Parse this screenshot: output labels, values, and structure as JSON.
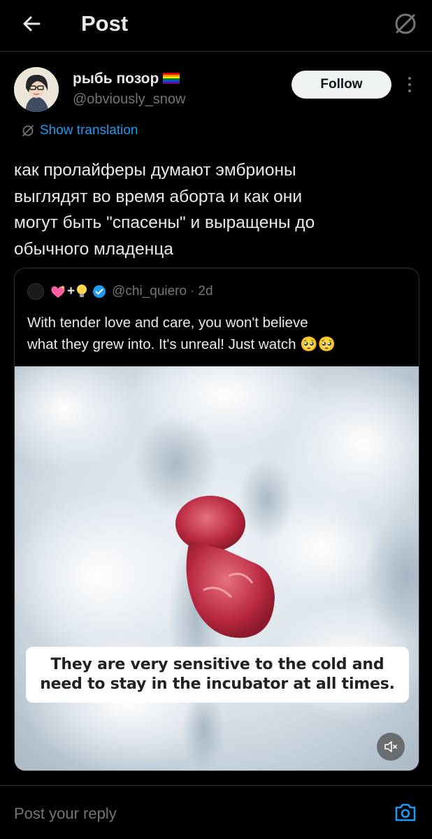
{
  "header": {
    "title": "Post"
  },
  "author": {
    "display_name": "рыбь позор",
    "handle": "@obviously_snow",
    "follow_label": "Follow"
  },
  "translation_label": "Show translation",
  "post": {
    "text_lines": [
      "как пролайферы думают эмбрионы",
      "выглядят во время аборта и как они",
      "могут быть \"спасены\" и выращены до",
      "обычного младенца"
    ]
  },
  "quote": {
    "handle": "@chi_quiero",
    "separator": "·",
    "time": "2d",
    "text_lines": [
      "With tender love and care, you won't believe",
      "what they grew into. It's unreal! Just watch 🥺🥺"
    ],
    "video_caption_lines": [
      "They are very sensitive to the cold and",
      "need to stay in the incubator at all times."
    ]
  },
  "reply": {
    "placeholder": "Post your reply"
  },
  "colors": {
    "background": "#000000",
    "text_primary": "#e7e9ea",
    "text_secondary": "#71767b",
    "accent": "#1d9bf0",
    "border": "#2f3336",
    "follow_bg": "#eff3f4"
  },
  "icons": {
    "back": "arrow-left-icon",
    "no_translate": "slashed-circle-icon",
    "more": "vertical-ellipsis-icon",
    "verified": "verified-badge-icon",
    "mute": "speaker-muted-icon",
    "camera": "camera-icon",
    "flag": "rainbow-flag-icon"
  }
}
